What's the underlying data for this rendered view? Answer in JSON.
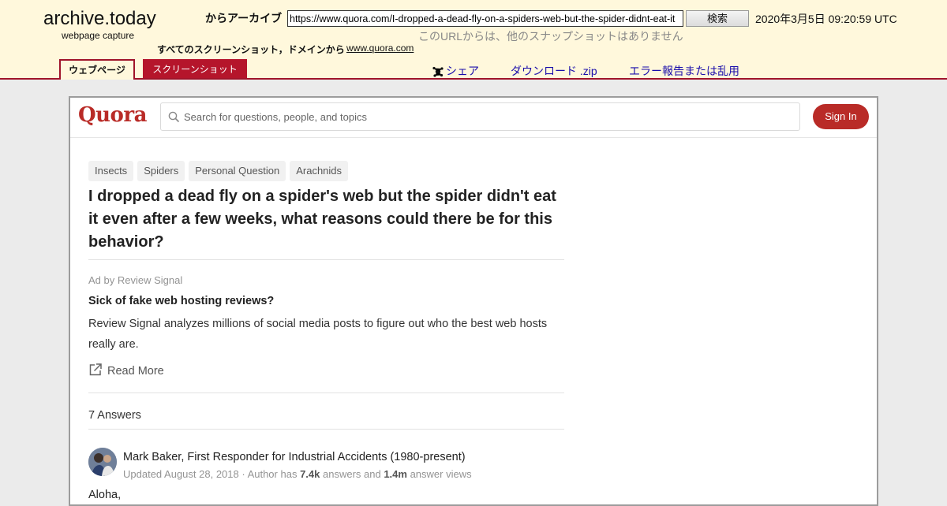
{
  "archive": {
    "logo": "archive.today",
    "subtitle": "webpage capture",
    "from_label": "からアーカイブ",
    "url_value": "https://www.quora.com/I-dropped-a-dead-fly-on-a-spiders-web-but-the-spider-didnt-eat-it",
    "search_button": "検索",
    "timestamp": "2020年3月5日 09:20:59 UTC",
    "no_snapshots": "このURLからは、他のスナップショットはありません",
    "all_screenshots_label": "すべてのスクリーンショット，ドメインから",
    "domain_link": "www.quora.com",
    "tabs": [
      {
        "label": "ウェブページ"
      },
      {
        "label": "スクリーンショット"
      }
    ],
    "share_label": "シェア",
    "download_label": "ダウンロード .zip",
    "report_label": "エラー報告または乱用",
    "accent_color": "#a0142a"
  },
  "quora": {
    "logo": "Quora",
    "search_placeholder": "Search for questions, people, and topics",
    "signin": "Sign In",
    "brand_color": "#b92b27",
    "tags": [
      "Insects",
      "Spiders",
      "Personal Question",
      "Arachnids"
    ],
    "question_title": "I dropped a dead fly on a spider's web but the spider didn't eat it even after a few weeks, what reasons could there be for this behavior?",
    "ad": {
      "by": "Ad by Review Signal",
      "title": "Sick of fake web hosting reviews?",
      "body": "Review Signal analyzes millions of social media posts to figure out who the best web hosts really are.",
      "read_more": "Read More"
    },
    "answers_count": "7 Answers",
    "answer": {
      "author": "Mark Baker, First Responder for Industrial Accidents (1980-present)",
      "meta_prefix": "Updated August 28, 2018 · Author has ",
      "answers_num": "7.4k",
      "meta_mid": " answers and ",
      "views_num": "1.4m",
      "meta_suffix": " answer views",
      "first_line": "Aloha,"
    }
  }
}
